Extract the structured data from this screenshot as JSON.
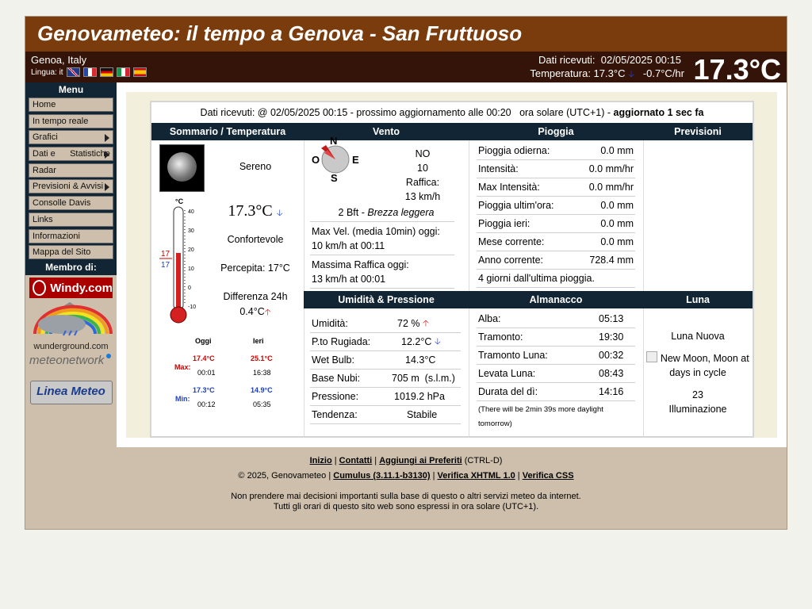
{
  "site_title": "Genovameteo: il tempo a Genova - San Fruttuoso",
  "header": {
    "location": "Genoa, Italy",
    "language_label": "Lingua: it",
    "received_label": "Dati ricevuti:",
    "received_value": "02/05/2025 00:15",
    "temperature_label": "Temperatura: 17.3°C",
    "trend": "-0.7°C/hr",
    "current_temp": "17.3°C"
  },
  "menu": {
    "title": "Menu",
    "items": [
      {
        "label": "Home"
      },
      {
        "label": "In tempo reale"
      },
      {
        "label": "Grafici"
      },
      {
        "label": "Dati e      Statistiche"
      },
      {
        "label": "Radar"
      },
      {
        "label": "Previsioni & Avvisi"
      },
      {
        "label": "Consolle Davis"
      },
      {
        "label": "Links"
      },
      {
        "label": "Informazioni"
      },
      {
        "label": "Mappa del Sito"
      }
    ],
    "member_title": "Membro di:",
    "logos": {
      "windy": "Windy.com",
      "wu": "wunderground.com",
      "mn": "meteonetwork",
      "lm": "Linea Meteo"
    }
  },
  "top_info": {
    "received": "Dati ricevuti: @ 02/05/2025 00:15 - prossimo aggiornamento alle 00:20",
    "time_note": "ora solare (UTC+1) -",
    "updated": "aggiornato 1 sec fa"
  },
  "headers": {
    "summary": "Sommario / Temperatura",
    "wind": "Vento",
    "rain": "Pioggia",
    "forecast": "Previsioni",
    "humidity": "Umidità & Pressione",
    "almanac": "Almanacco",
    "moon": "Luna"
  },
  "summary": {
    "condition": "Sereno",
    "temp": "17.3°C",
    "comfort": "Confortevole",
    "perceived": "Percepita: 17°C",
    "diff_label": "Differenza 24h",
    "diff_value": "0.4°C",
    "thermo_unit": "°C",
    "thermo_ticks": [
      "40",
      "30",
      "20",
      "10",
      "0",
      "-10"
    ],
    "thermo_max": "17",
    "thermo_min": "17",
    "minmax": {
      "col_today": "Oggi",
      "col_yesterday": "Ieri",
      "max_label": "Max:",
      "min_label": "Min:",
      "max_today": "17.4°C",
      "max_today_time": "00:01",
      "max_yest": "25.1°C",
      "max_yest_time": "16:38",
      "min_today": "17.3°C",
      "min_today_time": "00:12",
      "min_yest": "14.9°C",
      "min_yest_time": "05:35"
    }
  },
  "wind": {
    "dir": "NO",
    "speed": "10",
    "gust_label": "Raffica:",
    "gust": "13 km/h",
    "compass": {
      "n": "N",
      "e": "E",
      "s": "S",
      "w": "O"
    },
    "beaufort": "2 Bft -",
    "beaufort_desc": "Brezza leggera",
    "maxvel_label": "Max Vel. (media 10min) oggi:",
    "maxvel_value": "10 km/h at 00:11",
    "maxgust_label": "Massima Raffica oggi:",
    "maxgust_value": "13 km/h at 00:01"
  },
  "rain": {
    "rows": [
      {
        "label": "Pioggia odierna:",
        "value": "0.0 mm"
      },
      {
        "label": "Intensità:",
        "value": "0.0 mm/hr"
      },
      {
        "label": "Max Intensità:",
        "value": "0.0 mm/hr"
      },
      {
        "label": "Pioggia ultim'ora:",
        "value": "0.0 mm"
      },
      {
        "label": "Pioggia ieri:",
        "value": "0.0 mm"
      },
      {
        "label": "Mese corrente:",
        "value": "0.0 mm"
      },
      {
        "label": "Anno corrente:",
        "value": "728.4 mm"
      }
    ],
    "last_rain": "4 giorni dall'ultima pioggia."
  },
  "humidity": {
    "rows": [
      {
        "label": "Umidità:",
        "value": "72 %"
      },
      {
        "label": "P.to Rugiada:",
        "value": "12.2°C"
      },
      {
        "label": "Wet Bulb:",
        "value": "14.3°C"
      },
      {
        "label": "Base Nubi:",
        "value": "705 m  (s.l.m.)"
      },
      {
        "label": "Pressione:",
        "value": "1019.2 hPa"
      },
      {
        "label": "Tendenza:",
        "value": "Stabile"
      }
    ]
  },
  "almanac": {
    "rows": [
      {
        "label": "Alba:",
        "value": "05:13"
      },
      {
        "label": "Tramonto:",
        "value": "19:30"
      },
      {
        "label": "Tramonto Luna:",
        "value": "00:32"
      },
      {
        "label": "Levata Luna:",
        "value": "08:43"
      },
      {
        "label": "Durata del dì:",
        "value": "14:16"
      }
    ],
    "note": "(There will be 2min 39s more daylight tomorrow)"
  },
  "moon": {
    "phase": "Luna Nuova",
    "img_alt": "New Moon, Moon at days in cycle",
    "illum_value": "23",
    "illum_label": "Illuminazione"
  },
  "footer": {
    "links": [
      "Inizio",
      "Contatti",
      "Aggiungi ai Preferiti"
    ],
    "ctrl": "(CTRL-D)",
    "copyright": "© 2025, Genovameteo |",
    "cumulus": "Cumulus (3.11.1-b3130)",
    "xhtml": "Verifica XHTML 1.0",
    "css": "Verifica CSS",
    "disclaimer1": "Non prendere mai decisioni importanti sulla base di questo o altri servizi meteo da internet.",
    "disclaimer2": "Tutti gli orari di questo sito web sono espressi in ora solare (UTC+1)."
  }
}
